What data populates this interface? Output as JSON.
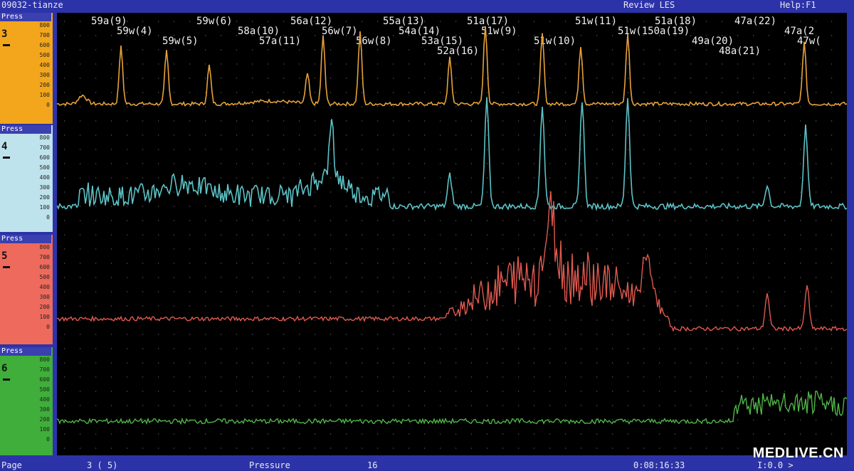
{
  "titlebar": {
    "left": "09032-tianze",
    "review": "Review LES",
    "help": "Help:F1"
  },
  "channels": [
    {
      "tab": "Press",
      "number": "3",
      "color": "#f3a61c",
      "ticks": [
        "800",
        "700",
        "600",
        "500",
        "400",
        "300",
        "200",
        "100",
        "0"
      ]
    },
    {
      "tab": "Press",
      "number": "4",
      "color": "#bfe3ec",
      "ticks": [
        "800",
        "700",
        "600",
        "500",
        "400",
        "300",
        "200",
        "100",
        "0"
      ]
    },
    {
      "tab": "Press",
      "number": "5",
      "color": "#ee6a5c",
      "ticks": [
        "800",
        "700",
        "600",
        "500",
        "400",
        "300",
        "200",
        "100",
        "0"
      ]
    },
    {
      "tab": "Press",
      "number": "6",
      "color": "#3fae3a",
      "ticks": [
        "800",
        "700",
        "600",
        "500",
        "400",
        "300",
        "200",
        "100",
        "0"
      ]
    }
  ],
  "traces": {
    "ch3": "#e7a23a",
    "ch4": "#5cc3c6",
    "ch5": "#e05a50",
    "ch6": "#4fb548"
  },
  "swallow_labels": {
    "row1": [
      "59a(9)",
      "59w(6)",
      "56a(12)",
      "55a(13)",
      "51a(17)",
      "51w(11)",
      "51a(18)",
      "47a(22)"
    ],
    "row2": [
      "59w(4)",
      "58a(10)",
      "56w(7)",
      "54a(14)",
      "51w(9)",
      "51w(150a(19)",
      "47a(2"
    ],
    "row3": [
      "59w(5)",
      "57a(11)",
      "56w(8)",
      "53a(15)",
      "51w(10)",
      "49a(20)",
      "47w("
    ],
    "row4": [
      "52a(16)",
      "48a(21)"
    ]
  },
  "statusbar": {
    "page": "Page",
    "page_value": "3 (  5)",
    "pressure": "Pressure",
    "pressure_value": "16",
    "time": "0:08:16:33",
    "scale": "I:0.0 >"
  },
  "watermark": "MEDLIVE.CN"
}
